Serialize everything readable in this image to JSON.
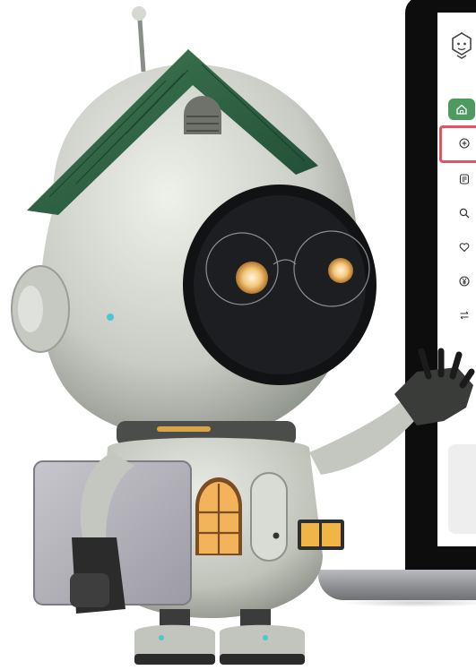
{
  "sidebar": {
    "items": [
      {
        "icon": "home-icon",
        "state": "active"
      },
      {
        "icon": "plus-circle-icon",
        "state": "highlighted"
      },
      {
        "icon": "document-icon"
      },
      {
        "icon": "search-icon"
      },
      {
        "icon": "heart-icon"
      },
      {
        "icon": "yen-icon"
      },
      {
        "icon": "swap-icon"
      }
    ]
  },
  "colors": {
    "accent_green": "#4f9a5e",
    "highlight_red": "#e25464",
    "bezel": "#0d0d0d"
  }
}
